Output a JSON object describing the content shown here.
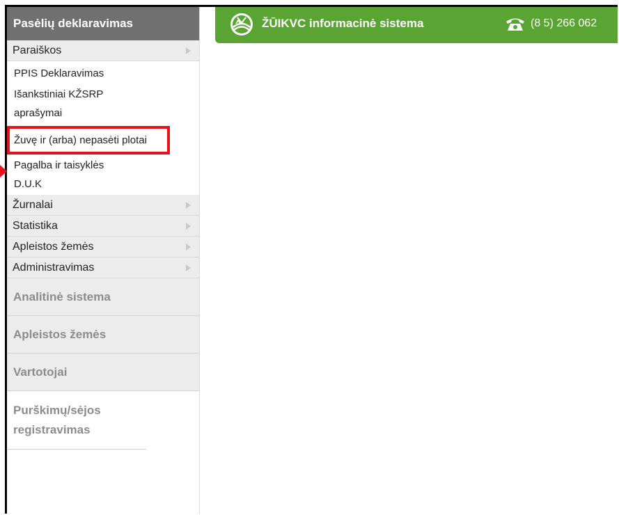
{
  "sidebar": {
    "header": "Pasėlių deklaravimas",
    "menu": [
      {
        "label": "Paraiškos",
        "has_arrow": true
      },
      {
        "label": "Žurnalai",
        "has_arrow": true
      },
      {
        "label": "Statistika",
        "has_arrow": true
      },
      {
        "label": "Apleistos žemės",
        "has_arrow": true
      },
      {
        "label": "Administravimas",
        "has_arrow": true
      }
    ],
    "submenu": [
      {
        "label": "PPIS Deklaravimas"
      },
      {
        "label": "Išankstiniai KŽSRP aprašymai"
      },
      {
        "label": "Žuvę ir (arba) nepasėti plotai",
        "highlighted": true
      },
      {
        "label": "Pagalba ir taisyklės"
      },
      {
        "label": "D.U.K"
      }
    ],
    "sections": [
      {
        "label": "Analitinė sistema"
      },
      {
        "label": "Apleistos žemės"
      },
      {
        "label": "Vartotojai"
      },
      {
        "label": "Purškimų/sėjos registravimas"
      }
    ]
  },
  "topbar": {
    "title": "ŽŪIKVC informacinė sistema",
    "phone": "(8 5) 266 062",
    "logo_icon": "zuikvc-logo-icon",
    "phone_icon": "telephone-icon"
  },
  "colors": {
    "topbar_green": "#5aa434",
    "sidebar_header": "#707070",
    "highlight_red": "#e8101a"
  }
}
